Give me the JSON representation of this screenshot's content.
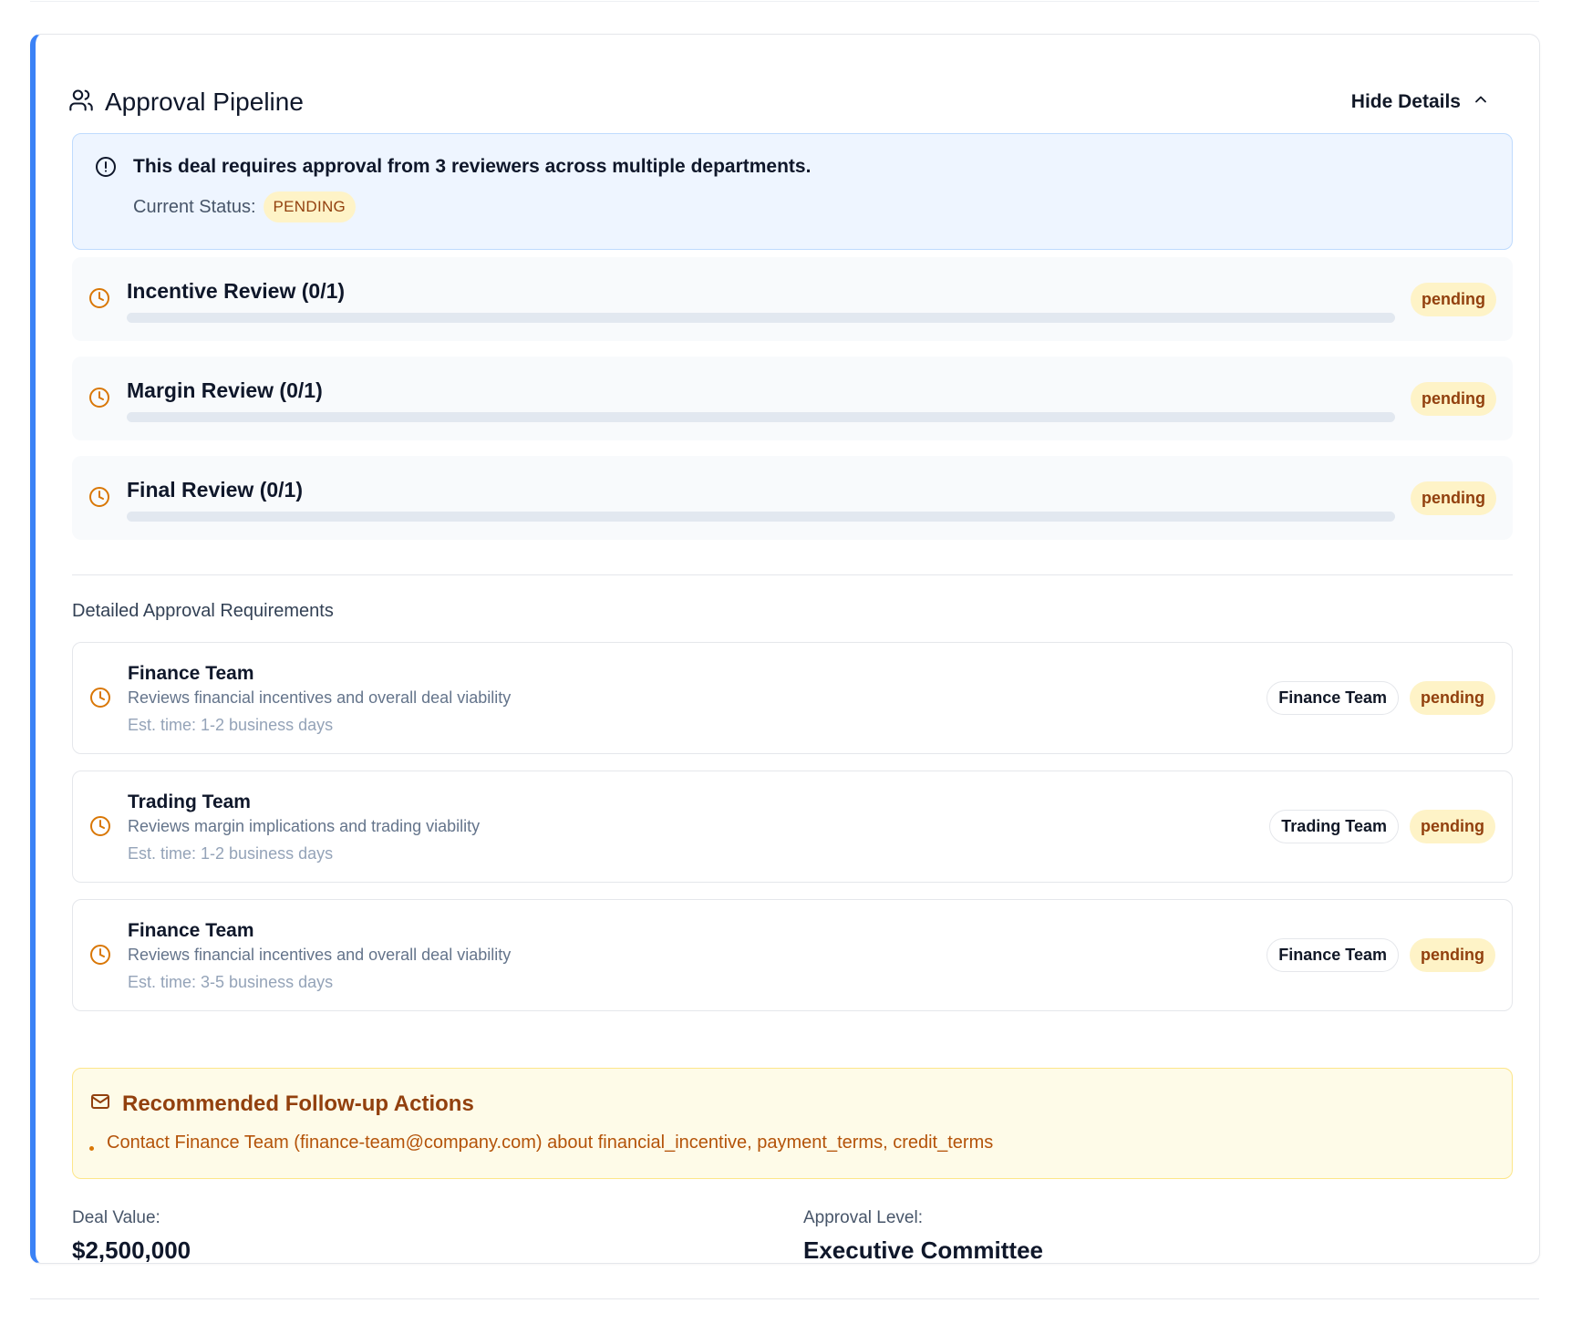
{
  "colors": {
    "accent": "#3b82f6",
    "pending_bg": "#fef3c7",
    "pending_text": "#92400e",
    "clock_icon": "#d97706"
  },
  "header": {
    "title": "Approval Pipeline",
    "icon": "users-icon",
    "toggle_label": "Hide Details",
    "toggle_icon": "chevron-up-icon"
  },
  "alert": {
    "icon": "alert-circle-icon",
    "message": "This deal requires approval from 3 reviewers across multiple departments.",
    "status_label": "Current Status:",
    "status_value": "PENDING"
  },
  "stages": [
    {
      "title": "Incentive Review (0/1)",
      "status": "pending",
      "progress": 0
    },
    {
      "title": "Margin Review (0/1)",
      "status": "pending",
      "progress": 0
    },
    {
      "title": "Final Review (0/1)",
      "status": "pending",
      "progress": 0
    }
  ],
  "requirements": {
    "section_title": "Detailed Approval Requirements",
    "items": [
      {
        "name": "Finance Team",
        "description": "Reviews financial incentives and overall deal viability",
        "time": "Est. time: 1-2 business days",
        "team": "Finance Team",
        "status": "pending"
      },
      {
        "name": "Trading Team",
        "description": "Reviews margin implications and trading viability",
        "time": "Est. time: 1-2 business days",
        "team": "Trading Team",
        "status": "pending"
      },
      {
        "name": "Finance Team",
        "description": "Reviews financial incentives and overall deal viability",
        "time": "Est. time: 3-5 business days",
        "team": "Finance Team",
        "status": "pending"
      }
    ]
  },
  "followup": {
    "icon": "mail-icon",
    "title": "Recommended Follow-up Actions",
    "items": [
      "Contact Finance Team (finance-team@company.com) about financial_incentive, payment_terms, credit_terms"
    ]
  },
  "summary": {
    "deal_value_label": "Deal Value:",
    "deal_value": "$2,500,000",
    "approval_level_label": "Approval Level:",
    "approval_level": "Executive Committee"
  }
}
